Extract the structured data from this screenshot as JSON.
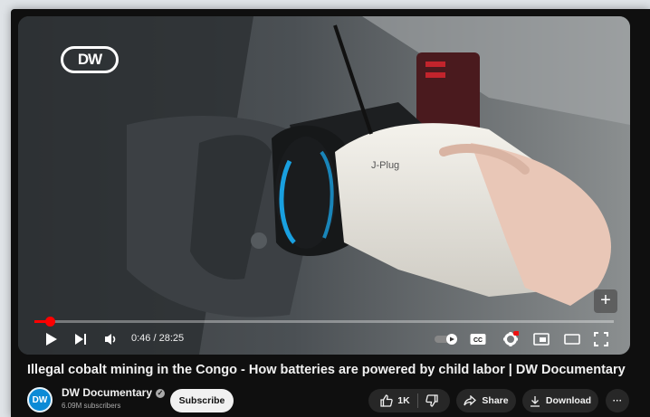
{
  "channel_logo_text": "DW",
  "player": {
    "current_time": "0:46",
    "duration": "28:25",
    "time_display": "0:46 / 28:25",
    "progress_fraction": 0.027,
    "cc_label": "CC",
    "accent_color": "#ff0000"
  },
  "video": {
    "title": "Illegal cobalt mining in the Congo - How batteries are powered by child labor | DW Documentary",
    "plug_label": "J-Plug"
  },
  "channel": {
    "name": "DW Documentary",
    "subscribers": "6.09M subscribers",
    "avatar_text": "DW"
  },
  "actions": {
    "subscribe_label": "Subscribe",
    "like_count": "1K",
    "share_label": "Share",
    "download_label": "Download",
    "more_label": "···"
  },
  "icons": [
    "play-icon",
    "next-icon",
    "volume-icon",
    "autoplay-toggle-icon",
    "cc-icon",
    "settings-icon",
    "miniplayer-icon",
    "theater-icon",
    "fullscreen-icon",
    "plus-icon",
    "like-icon",
    "dislike-icon",
    "share-icon",
    "download-icon",
    "more-icon",
    "verified-icon"
  ]
}
